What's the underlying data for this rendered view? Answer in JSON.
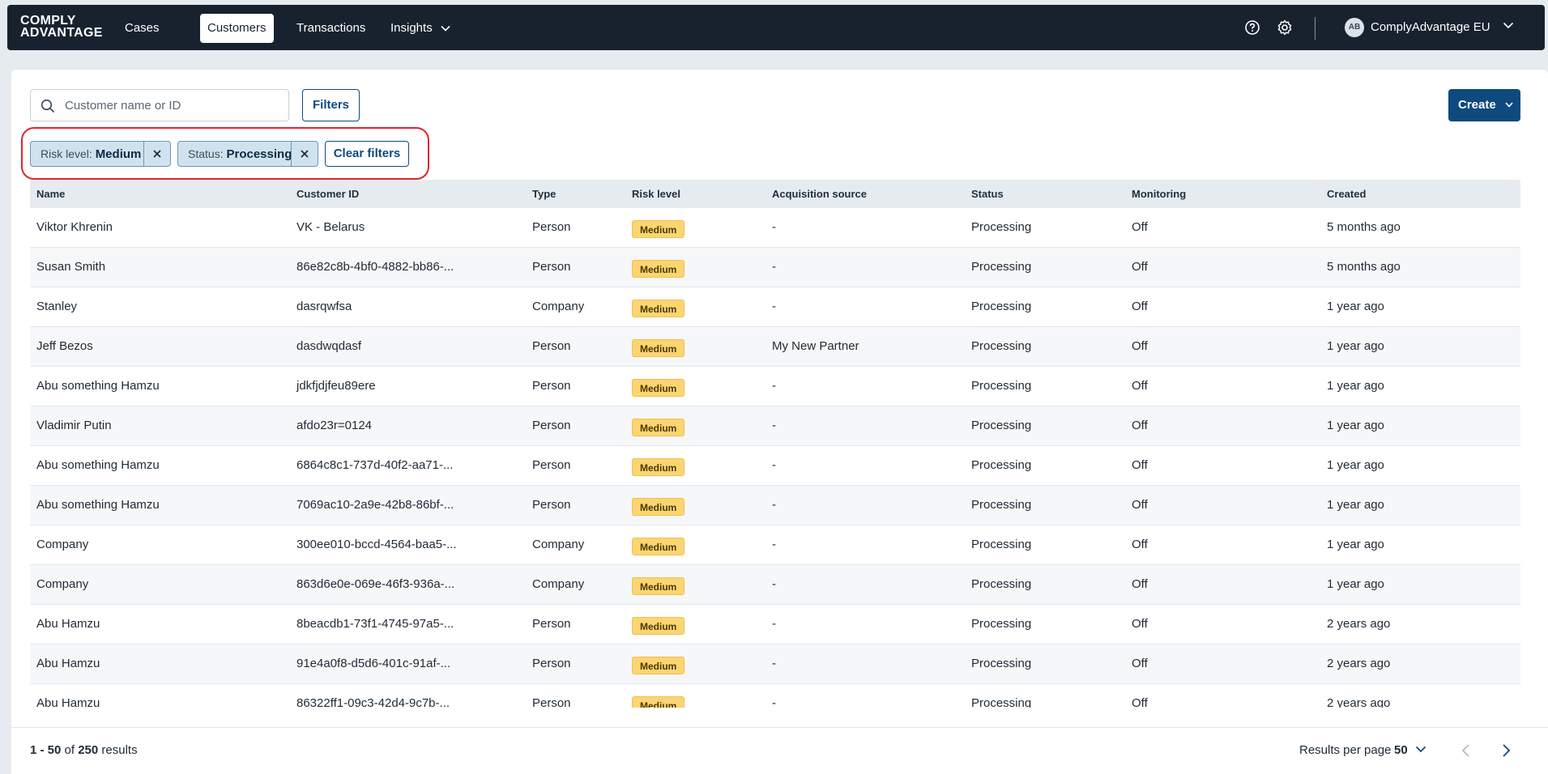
{
  "brand": {
    "line1": "COMPLY",
    "line2": "ADVANTAGE"
  },
  "nav": [
    {
      "label": "Cases"
    },
    {
      "label": "Customers",
      "active": true
    },
    {
      "label": "Transactions"
    },
    {
      "label": "Insights",
      "has_dropdown": true
    }
  ],
  "header": {
    "help_icon": "help-circle-icon",
    "settings_icon": "gear-icon",
    "avatar_initials": "AB",
    "account_name": "ComplyAdvantage EU"
  },
  "toolbar": {
    "search_placeholder": "Customer name or ID",
    "filters_label": "Filters",
    "create_label": "Create"
  },
  "active_filters": [
    {
      "key": "Risk level:",
      "value": "Medium"
    },
    {
      "key": "Status:",
      "value": "Processing"
    }
  ],
  "clear_filters_label": "Clear filters",
  "table": {
    "columns": [
      "Name",
      "Customer ID",
      "Type",
      "Risk level",
      "Acquisition source",
      "Status",
      "Monitoring",
      "Created"
    ],
    "rows": [
      {
        "name": "Viktor Khrenin",
        "id": "VK - Belarus",
        "type": "Person",
        "risk": "Medium",
        "source": "-",
        "status": "Processing",
        "monitoring": "Off",
        "created": "5 months ago"
      },
      {
        "name": "Susan Smith",
        "id": "86e82c8b-4bf0-4882-bb86-...",
        "type": "Person",
        "risk": "Medium",
        "source": "-",
        "status": "Processing",
        "monitoring": "Off",
        "created": "5 months ago"
      },
      {
        "name": "Stanley",
        "id": "dasrqwfsa",
        "type": "Company",
        "risk": "Medium",
        "source": "-",
        "status": "Processing",
        "monitoring": "Off",
        "created": "1 year ago"
      },
      {
        "name": "Jeff Bezos",
        "id": "dasdwqdasf",
        "type": "Person",
        "risk": "Medium",
        "source": "My New Partner",
        "status": "Processing",
        "monitoring": "Off",
        "created": "1 year ago"
      },
      {
        "name": "Abu something Hamzu",
        "id": "jdkfjdjfeu89ere",
        "type": "Person",
        "risk": "Medium",
        "source": "-",
        "status": "Processing",
        "monitoring": "Off",
        "created": "1 year ago"
      },
      {
        "name": "Vladimir Putin",
        "id": "afdo23r=0124",
        "type": "Person",
        "risk": "Medium",
        "source": "-",
        "status": "Processing",
        "monitoring": "Off",
        "created": "1 year ago"
      },
      {
        "name": "Abu something Hamzu",
        "id": "6864c8c1-737d-40f2-aa71-...",
        "type": "Person",
        "risk": "Medium",
        "source": "-",
        "status": "Processing",
        "monitoring": "Off",
        "created": "1 year ago"
      },
      {
        "name": "Abu something Hamzu",
        "id": "7069ac10-2a9e-42b8-86bf-...",
        "type": "Person",
        "risk": "Medium",
        "source": "-",
        "status": "Processing",
        "monitoring": "Off",
        "created": "1 year ago"
      },
      {
        "name": "Company",
        "id": "300ee010-bccd-4564-baa5-...",
        "type": "Company",
        "risk": "Medium",
        "source": "-",
        "status": "Processing",
        "monitoring": "Off",
        "created": "1 year ago"
      },
      {
        "name": "Company",
        "id": "863d6e0e-069e-46f3-936a-...",
        "type": "Company",
        "risk": "Medium",
        "source": "-",
        "status": "Processing",
        "monitoring": "Off",
        "created": "1 year ago"
      },
      {
        "name": "Abu Hamzu",
        "id": "8beacdb1-73f1-4745-97a5-...",
        "type": "Person",
        "risk": "Medium",
        "source": "-",
        "status": "Processing",
        "monitoring": "Off",
        "created": "2 years ago"
      },
      {
        "name": "Abu Hamzu",
        "id": "91e4a0f8-d5d6-401c-91af-...",
        "type": "Person",
        "risk": "Medium",
        "source": "-",
        "status": "Processing",
        "monitoring": "Off",
        "created": "2 years ago"
      },
      {
        "name": "Abu Hamzu",
        "id": "86322ff1-09c3-42d4-9c7b-...",
        "type": "Person",
        "risk": "Medium",
        "source": "-",
        "status": "Processing",
        "monitoring": "Off",
        "created": "2 years ago"
      }
    ]
  },
  "footer": {
    "range": "1 - 50",
    "of_word": "of",
    "total": "250",
    "results_word": "results",
    "per_page_label": "Results per page",
    "per_page_value": "50"
  },
  "colors": {
    "navbar": "#18222f",
    "primary": "#0e4a7d",
    "chip_bg": "#cfe3ef",
    "badge_medium": "#fcd573",
    "highlight": "#e0252b"
  }
}
